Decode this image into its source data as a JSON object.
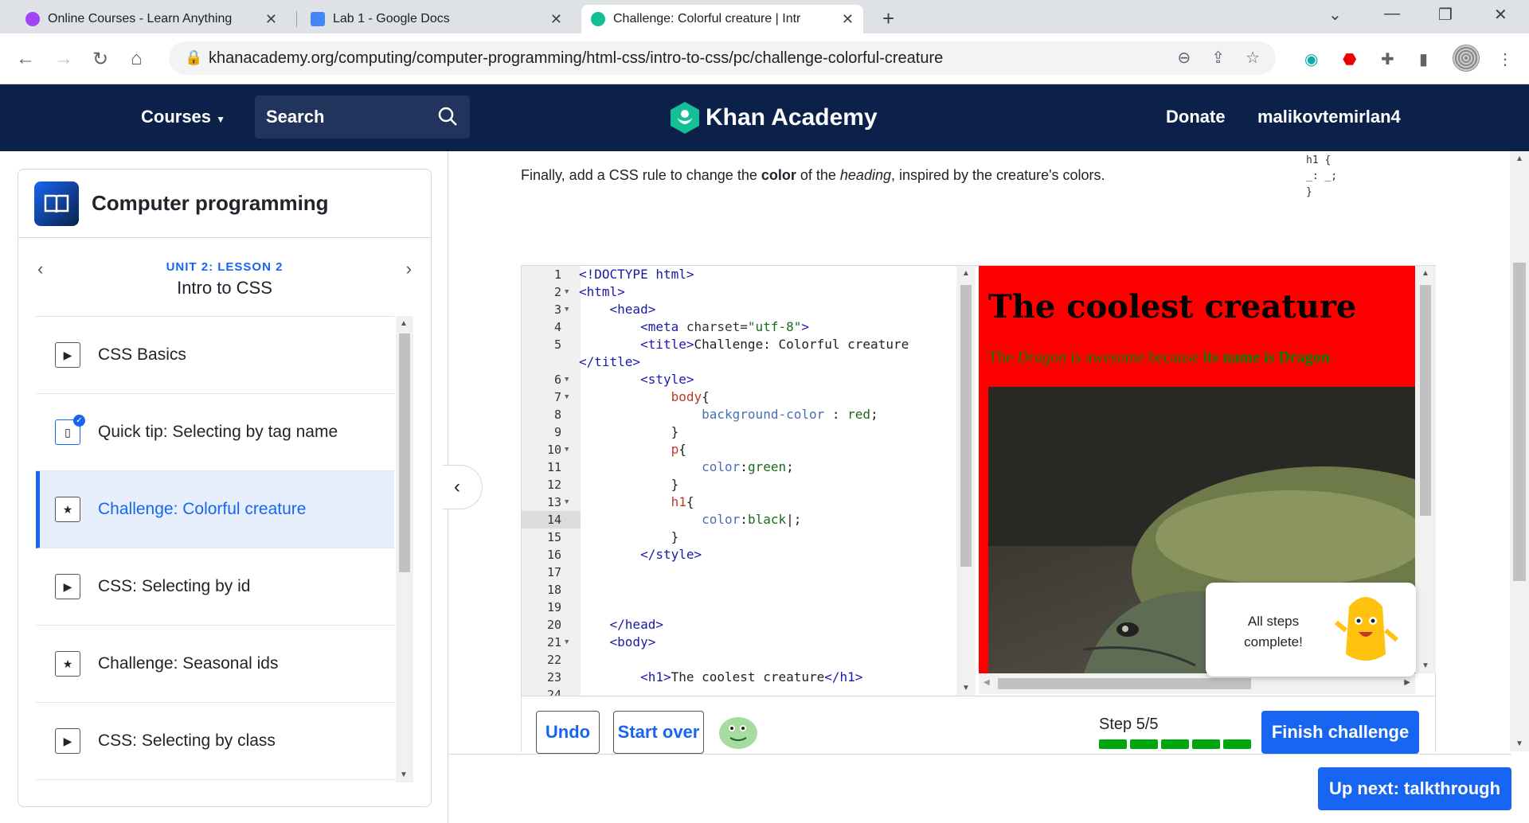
{
  "browser": {
    "tabs": [
      {
        "title": "Online Courses - Learn Anything",
        "icon_color": "#a142f4"
      },
      {
        "title": "Lab 1 - Google Docs",
        "icon_color": "#4285f4"
      },
      {
        "title": "Challenge: Colorful creature | Intr",
        "icon_color": "#14bf96"
      }
    ],
    "url": "khanacademy.org/computing/computer-programming/html-css/intro-to-css/pc/challenge-colorful-creature"
  },
  "header": {
    "courses_label": "Courses",
    "search_label": "Search",
    "brand": "Khan Academy",
    "donate_label": "Donate",
    "username": "malikovtemirlan4"
  },
  "sidebar": {
    "course_title": "Computer programming",
    "unit_label": "UNIT 2: LESSON 2",
    "lesson_title": "Intro to CSS",
    "items": [
      {
        "label": "CSS Basics",
        "icon": "play-icon"
      },
      {
        "label": "Quick tip: Selecting by tag name",
        "icon": "talkthrough-icon"
      },
      {
        "label": "Challenge: Colorful creature",
        "icon": "star-icon"
      },
      {
        "label": "CSS: Selecting by id",
        "icon": "play-icon"
      },
      {
        "label": "Challenge: Seasonal ids",
        "icon": "star-icon"
      },
      {
        "label": "CSS: Selecting by class",
        "icon": "play-icon"
      }
    ]
  },
  "instruction": {
    "prefix": "Finally, add a CSS rule to change the ",
    "bold": "color",
    "middle": " of the ",
    "italic": "heading",
    "suffix": ", inspired by the creature's colors."
  },
  "snippet": "h1 {\n_: _;\n}",
  "editor": {
    "active_line": 14,
    "lines": [
      {
        "n": "1",
        "fold": false,
        "indent": "",
        "parts": [
          [
            "t-tag",
            "<!DOCTYPE html>"
          ]
        ]
      },
      {
        "n": "2",
        "fold": true,
        "indent": "",
        "parts": [
          [
            "t-tag",
            "<html>"
          ]
        ]
      },
      {
        "n": "3",
        "fold": true,
        "indent": "    ",
        "parts": [
          [
            "t-tag",
            "<head>"
          ]
        ]
      },
      {
        "n": "4",
        "fold": false,
        "indent": "        ",
        "parts": [
          [
            "t-tag",
            "<meta "
          ],
          [
            "t-attr",
            "charset="
          ],
          [
            "t-str",
            "\"utf-8\""
          ],
          [
            "t-tag",
            ">"
          ]
        ]
      },
      {
        "n": "5",
        "fold": false,
        "indent": "        ",
        "parts": [
          [
            "t-tag",
            "<title>"
          ],
          [
            "t-txt",
            "Challenge: Colorful creature"
          ]
        ]
      },
      {
        "n": "",
        "fold": false,
        "indent": "",
        "parts": [
          [
            "t-tag",
            "</title>"
          ]
        ]
      },
      {
        "n": "6",
        "fold": true,
        "indent": "        ",
        "parts": [
          [
            "t-tag",
            "<style>"
          ]
        ]
      },
      {
        "n": "7",
        "fold": true,
        "indent": "            ",
        "parts": [
          [
            "t-sel",
            "body"
          ],
          [
            "t-txt",
            "{"
          ]
        ]
      },
      {
        "n": "8",
        "fold": false,
        "indent": "                ",
        "parts": [
          [
            "t-prop",
            "background-color"
          ],
          [
            "t-txt",
            " : "
          ],
          [
            "t-val",
            "red"
          ],
          [
            "t-txt",
            ";"
          ]
        ]
      },
      {
        "n": "9",
        "fold": false,
        "indent": "            ",
        "parts": [
          [
            "t-txt",
            "}"
          ]
        ]
      },
      {
        "n": "10",
        "fold": true,
        "indent": "            ",
        "parts": [
          [
            "t-sel",
            "p"
          ],
          [
            "t-txt",
            "{"
          ]
        ]
      },
      {
        "n": "11",
        "fold": false,
        "indent": "                ",
        "parts": [
          [
            "t-prop",
            "color"
          ],
          [
            "t-txt",
            ":"
          ],
          [
            "t-val",
            "green"
          ],
          [
            "t-txt",
            ";"
          ]
        ]
      },
      {
        "n": "12",
        "fold": false,
        "indent": "            ",
        "parts": [
          [
            "t-txt",
            "}"
          ]
        ]
      },
      {
        "n": "13",
        "fold": true,
        "indent": "            ",
        "parts": [
          [
            "t-sel",
            "h1"
          ],
          [
            "t-txt",
            "{"
          ]
        ]
      },
      {
        "n": "14",
        "fold": false,
        "indent": "                ",
        "parts": [
          [
            "t-prop",
            "color"
          ],
          [
            "t-txt",
            ":"
          ],
          [
            "t-val",
            "black"
          ],
          [
            "t-txt",
            "|;"
          ]
        ]
      },
      {
        "n": "15",
        "fold": false,
        "indent": "            ",
        "parts": [
          [
            "t-txt",
            "}"
          ]
        ]
      },
      {
        "n": "16",
        "fold": false,
        "indent": "        ",
        "parts": [
          [
            "t-tag",
            "</style>"
          ]
        ]
      },
      {
        "n": "17",
        "fold": false,
        "indent": "",
        "parts": []
      },
      {
        "n": "18",
        "fold": false,
        "indent": "",
        "parts": []
      },
      {
        "n": "19",
        "fold": false,
        "indent": "",
        "parts": []
      },
      {
        "n": "20",
        "fold": false,
        "indent": "    ",
        "parts": [
          [
            "t-tag",
            "</head>"
          ]
        ]
      },
      {
        "n": "21",
        "fold": true,
        "indent": "    ",
        "parts": [
          [
            "t-tag",
            "<body>"
          ]
        ]
      },
      {
        "n": "22",
        "fold": false,
        "indent": "",
        "parts": []
      },
      {
        "n": "23",
        "fold": false,
        "indent": "        ",
        "parts": [
          [
            "t-tag",
            "<h1>"
          ],
          [
            "t-txt",
            "The coolest creature"
          ],
          [
            "t-tag",
            "</h1>"
          ]
        ]
      },
      {
        "n": "24",
        "fold": false,
        "indent": "",
        "parts": []
      }
    ]
  },
  "preview": {
    "bg_color": "#ff0000",
    "heading": "The coolest creature",
    "para_prefix": "The ",
    "para_italic": "Dragon",
    "para_middle": " is awesome because ",
    "para_bold": "its name is Dragon",
    "para_suffix": "."
  },
  "toast": {
    "message": "All steps complete!"
  },
  "controls": {
    "undo_label": "Undo",
    "start_over_label": "Start over",
    "step_text": "Step 5/5",
    "finish_label": "Finish challenge",
    "up_next_label": "Up next: talkthrough"
  },
  "colors": {
    "ka_navy": "#0b2149",
    "ka_blue": "#1865f2",
    "progress_green": "#00a60e"
  }
}
